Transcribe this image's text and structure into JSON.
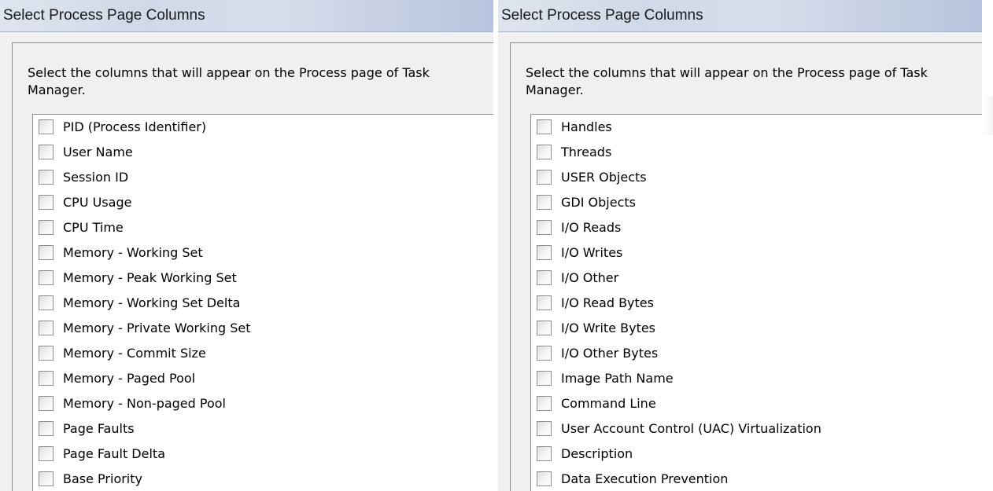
{
  "left_dialog": {
    "title": "Select Process Page Columns",
    "description_line1": "Select the columns that will appear on the Process page of Task",
    "description_line2": "Manager.",
    "items": [
      "PID (Process Identifier)",
      "User Name",
      "Session ID",
      "CPU Usage",
      "CPU Time",
      "Memory - Working Set",
      "Memory - Peak Working Set",
      "Memory - Working Set Delta",
      "Memory - Private Working Set",
      "Memory - Commit Size",
      "Memory - Paged Pool",
      "Memory - Non-paged Pool",
      "Page Faults",
      "Page Fault Delta",
      "Base Priority"
    ]
  },
  "right_dialog": {
    "title": "Select Process Page Columns",
    "description_line1": "Select the columns that will appear on the Process page of Task",
    "description_line2": "Manager.",
    "items": [
      "Handles",
      "Threads",
      "USER Objects",
      "GDI Objects",
      "I/O Reads",
      "I/O Writes",
      "I/O Other",
      "I/O Read Bytes",
      "I/O Write Bytes",
      "I/O Other Bytes",
      "Image Path Name",
      "Command Line",
      "User Account Control (UAC) Virtualization",
      "Description",
      "Data Execution Prevention"
    ]
  }
}
